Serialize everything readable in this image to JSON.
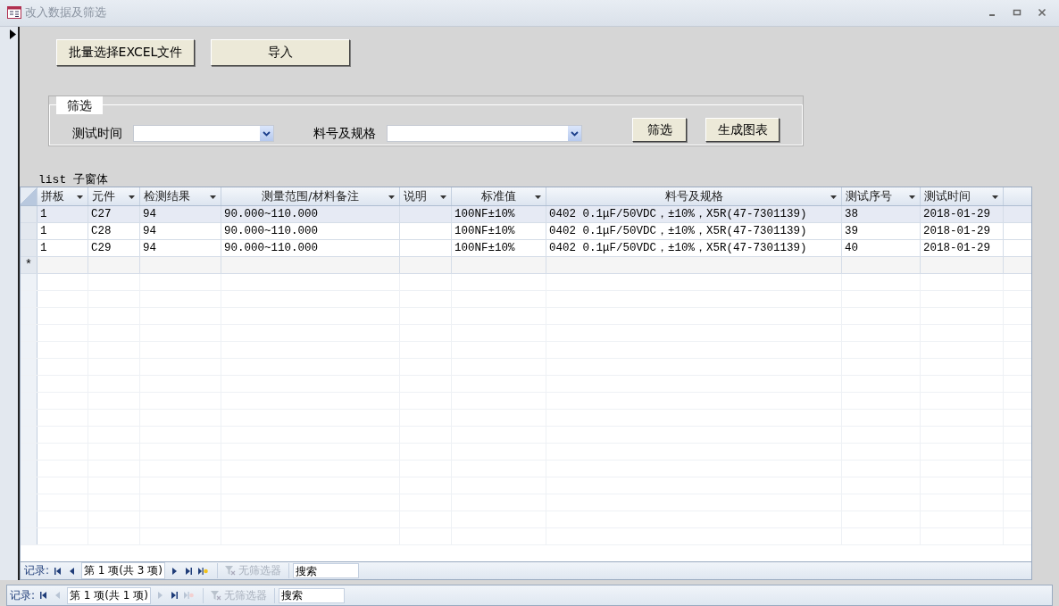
{
  "window": {
    "title": "改入数据及筛选"
  },
  "buttons": [
    {
      "label": "批量选择EXCEL文件"
    },
    {
      "label": "导入"
    }
  ],
  "filter": {
    "legend": "筛选",
    "fields": [
      {
        "label": "测试时间"
      },
      {
        "label": "料号及规格"
      }
    ],
    "buttons": [
      {
        "label": "筛选"
      },
      {
        "label": "生成图表"
      }
    ]
  },
  "subform": {
    "label": "list 子窗体",
    "columns": [
      {
        "label": "拼板"
      },
      {
        "label": "元件"
      },
      {
        "label": "检测结果"
      },
      {
        "label": "测量范围/材料备注"
      },
      {
        "label": "说明"
      },
      {
        "label": "标准值"
      },
      {
        "label": "料号及规格"
      },
      {
        "label": "测试序号"
      },
      {
        "label": "测试时间"
      }
    ],
    "rows": [
      {
        "selected": true,
        "cells": [
          "1",
          "C27",
          "94",
          "90.000~110.000",
          "",
          "100NF±10%",
          "0402 0.1μF/50VDC，±10%，X5R(47-7301139)",
          "38",
          "2018-01-29"
        ]
      },
      {
        "selected": false,
        "cells": [
          "1",
          "C28",
          "94",
          "90.000~110.000",
          "",
          "100NF±10%",
          "0402 0.1μF/50VDC，±10%，X5R(47-7301139)",
          "39",
          "2018-01-29"
        ]
      },
      {
        "selected": false,
        "cells": [
          "1",
          "C29",
          "94",
          "90.000~110.000",
          "",
          "100NF±10%",
          "0402 0.1μF/50VDC，±10%，X5R(47-7301139)",
          "40",
          "2018-01-29"
        ]
      }
    ],
    "new_row_marker": "*",
    "nav": {
      "label": "记录:",
      "before": [
        {
          "kind": "first",
          "disabled": false
        },
        {
          "kind": "prev",
          "disabled": false
        }
      ],
      "position": "第 1 项(共 3 项)",
      "after": [
        {
          "kind": "next",
          "disabled": false
        },
        {
          "kind": "last",
          "disabled": false
        },
        {
          "kind": "new",
          "disabled": false
        }
      ],
      "filter": "无筛选器",
      "search_placeholder": "搜索"
    }
  },
  "form_nav": {
    "label": "记录:",
    "before": [
      {
        "kind": "first",
        "disabled": false
      },
      {
        "kind": "prev",
        "disabled": true
      }
    ],
    "position": "第 1 项(共 1 项)",
    "after": [
      {
        "kind": "next",
        "disabled": true
      },
      {
        "kind": "last",
        "disabled": false
      },
      {
        "kind": "new",
        "disabled": true
      }
    ],
    "filter": "无筛选器",
    "search_placeholder": "搜索"
  }
}
